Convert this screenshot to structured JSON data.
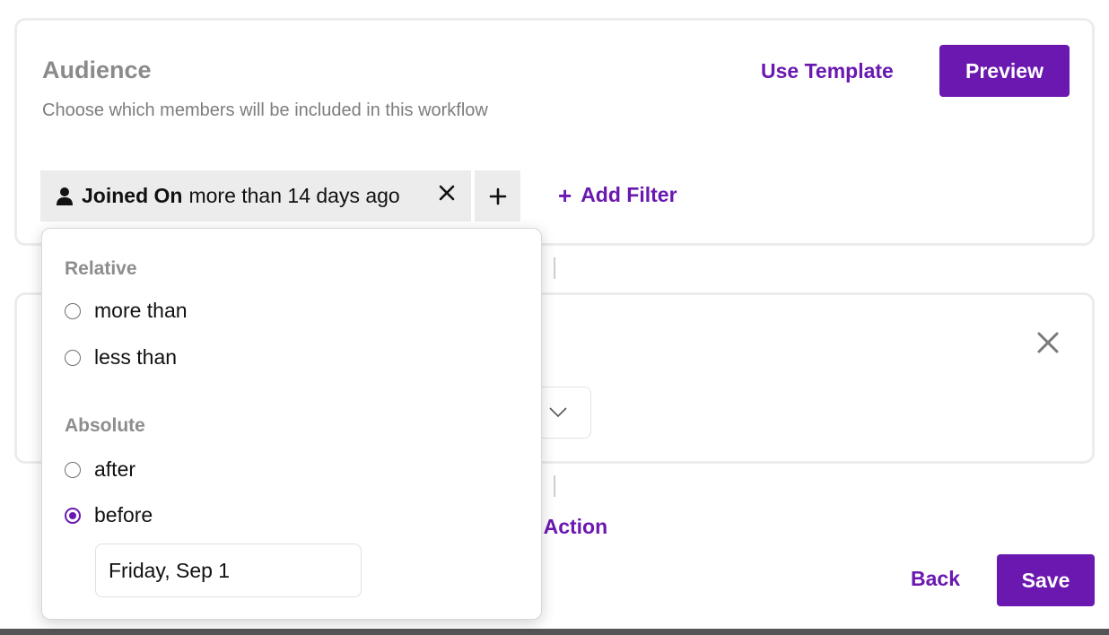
{
  "audience": {
    "title": "Audience",
    "subtitle": "Choose which members will be included in this workflow",
    "use_template_label": "Use Template",
    "preview_label": "Preview",
    "filter_chip": {
      "field": "Joined On",
      "value": "more than 14 days ago",
      "icon": "person-icon"
    },
    "add_filter_label": "Add Filter"
  },
  "dropdown": {
    "relative_label": "Relative",
    "relative_options": [
      "more than",
      "less than"
    ],
    "absolute_label": "Absolute",
    "absolute_options": [
      "after",
      "before"
    ],
    "selected_option": "before",
    "date_value": "Friday, Sep 1"
  },
  "action": {
    "add_action_label": "d Action"
  },
  "footer": {
    "back_label": "Back",
    "save_label": "Save"
  },
  "colors": {
    "accent": "#6a18b0",
    "muted_text": "#8a8a8a",
    "chip_bg": "#ececec"
  }
}
